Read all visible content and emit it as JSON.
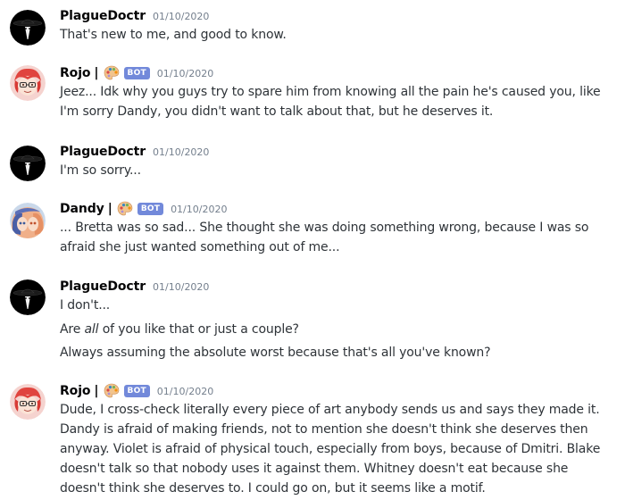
{
  "messages": [
    {
      "author": "PlagueDoctr",
      "avatar": "plague-doctor-avatar",
      "timestamp": "01/10/2020",
      "lines": [
        "That's new to me, and good to know."
      ]
    },
    {
      "author": "Rojo",
      "separator": "|",
      "badge_icon": "palette-icon",
      "bot_tag": "BOT",
      "avatar": "rojo-avatar",
      "timestamp": "01/10/2020",
      "lines": [
        "Jeez... Idk why you guys try to spare him from knowing all the pain he's caused you, like",
        "I'm sorry Dandy, you didn't want to talk about that, but he deserves it."
      ]
    },
    {
      "author": "PlagueDoctr",
      "avatar": "plague-doctor-avatar",
      "timestamp": "01/10/2020",
      "lines": [
        "I'm so sorry..."
      ]
    },
    {
      "author": "Dandy",
      "separator": "|",
      "badge_icon": "palette-icon",
      "bot_tag": "BOT",
      "avatar": "dandy-avatar",
      "timestamp": "01/10/2020",
      "lines": [
        "... Bretta was so sad... She thought she was doing something wrong, because I was so",
        "afraid she just wanted something out of me..."
      ]
    },
    {
      "author": "PlagueDoctr",
      "avatar": "plague-doctor-avatar",
      "timestamp": "01/10/2020",
      "lines": [
        "I don't...",
        {
          "before": "Are ",
          "emphasis": "all",
          "after": " of you like that or just a couple?"
        },
        "Always assuming the absolute worst because that's all you've known?"
      ]
    },
    {
      "author": "Rojo",
      "separator": "|",
      "badge_icon": "palette-icon",
      "bot_tag": "BOT",
      "avatar": "rojo-avatar",
      "timestamp": "01/10/2020",
      "lines": [
        "Dude, I cross-check literally every piece of art anybody sends us and says they made it.",
        "Dandy is afraid of making friends, not to mention she doesn't think she deserves then",
        "anyway. Violet is afraid of physical touch, especially from boys, because of Dmitri. Blake",
        "doesn't talk so that nobody uses it against them. Whitney doesn't eat because she",
        "doesn't think she deserves to. I could go on, but it seems like a motif."
      ]
    }
  ]
}
